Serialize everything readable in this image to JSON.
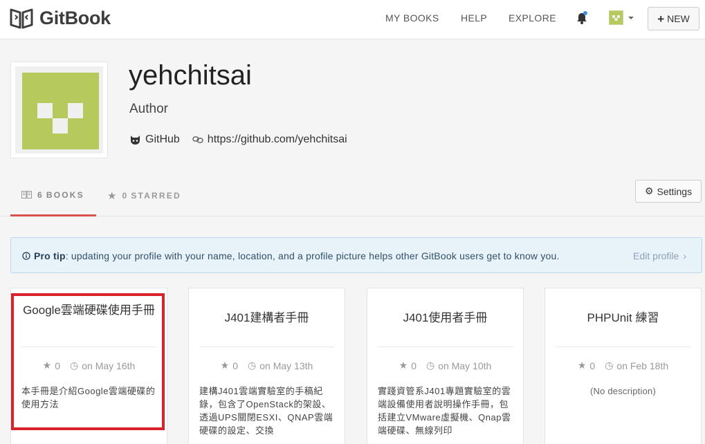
{
  "app": {
    "name": "GitBook"
  },
  "nav": {
    "my_books": "MY BOOKS",
    "help": "HELP",
    "explore": "EXPLORE",
    "new_label": "NEW"
  },
  "profile": {
    "username": "yehchitsai",
    "role": "Author",
    "github_label": "GitHub",
    "website": "https://github.com/yehchitsai"
  },
  "tabs": [
    {
      "count": "6",
      "label": "BOOKS"
    },
    {
      "count": "0",
      "label": "STARRED"
    }
  ],
  "settings_label": "Settings",
  "tip": {
    "prefix": "Pro tip",
    "text": ": updating your profile with your name, location, and a profile picture helps other GitBook users get to know you.",
    "edit": "Edit profile"
  },
  "books": [
    {
      "title": "Google雲端硬碟使用手冊",
      "stars": "0",
      "date": "on May 16th",
      "desc": "本手冊是介紹Google雲端硬碟的使用方法"
    },
    {
      "title": "J401建構者手冊",
      "stars": "0",
      "date": "on May 13th",
      "desc": "建構J401雲端實驗室的手稿紀錄，包含了OpenStack的架設、透過UPS關閉ESXI、QNAP雲端硬碟的設定、交換"
    },
    {
      "title": "J401使用者手冊",
      "stars": "0",
      "date": "on May 10th",
      "desc": "實踐資管系J401專題實驗室的雲端設備使用者說明操作手冊，包括建立VMware虛擬機、Qnap雲端硬碟、無線列印"
    },
    {
      "title": "PHPUnit 練習",
      "stars": "0",
      "date": "on Feb 18th",
      "desc": "(No description)"
    }
  ],
  "colors": {
    "accent": "#d9534f",
    "avatar": "#b5c95c",
    "highlight": "#d9222a"
  }
}
